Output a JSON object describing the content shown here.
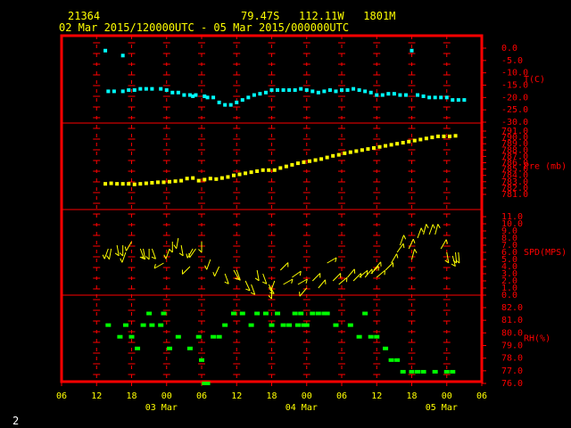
{
  "header": {
    "station": "21364",
    "location": "79.47S   112.11W   1801M",
    "period": "02 Mar 2015/120000UTC - 05 Mar 2015/000000UTC"
  },
  "footer": {
    "page": "2"
  },
  "colors": {
    "frame": "#ff0000",
    "panel_divider": "#ff0000",
    "ticks": "#ff0000",
    "axis_text": "#ff0000",
    "bottom_text": "#ffff00",
    "temperature": "#00ffff",
    "pressure": "#ffff00",
    "wind": "#ffff00",
    "rh": "#00ff00"
  },
  "chart_data": {
    "type": "scatter",
    "x_axis": {
      "unit": "hours since 02 Mar 2015 06 UTC",
      "range": [
        0,
        72
      ],
      "tick_values": [
        0,
        6,
        12,
        18,
        24,
        30,
        36,
        42,
        48,
        54,
        60,
        66,
        72
      ],
      "tick_labels": [
        "06",
        "12",
        "18",
        "00",
        "06",
        "12",
        "18",
        "00",
        "06",
        "12",
        "18",
        "00",
        "06"
      ],
      "date_labels": [
        {
          "at": 18,
          "text": "03 Mar"
        },
        {
          "at": 42,
          "text": "04 Mar"
        },
        {
          "at": 66,
          "text": "05 Mar"
        }
      ]
    },
    "panels": [
      {
        "name": "T(C)",
        "ylim": [
          -30,
          0
        ],
        "tick_labels": [
          "0.0",
          "-5.0",
          "-10.0",
          "-15.0",
          "-20.0",
          "-25.0",
          "-30.0"
        ],
        "series": [
          {
            "x": [
              7.5,
              10.5,
              8.0,
              9.0,
              10.5,
              11.5,
              12.5,
              13.5,
              14.5,
              15.5,
              17,
              18,
              19,
              20,
              21,
              22,
              22.5,
              23,
              24.5,
              25,
              26,
              27,
              28,
              29,
              30,
              31,
              32,
              33,
              34,
              35,
              36,
              37,
              38,
              39,
              40,
              41,
              42,
              43,
              44,
              45,
              46,
              47,
              48,
              49,
              50,
              51,
              52,
              53,
              54,
              55,
              56,
              57,
              58,
              59,
              60,
              61,
              62,
              63,
              64,
              65,
              66,
              67,
              68,
              69
            ],
            "y": [
              -1,
              -3,
              -17.5,
              -17.5,
              -17.5,
              -17,
              -17,
              -16.5,
              -16.5,
              -16.5,
              -16.5,
              -17,
              -18,
              -18,
              -19,
              -19,
              -19.5,
              -19,
              -19.5,
              -20,
              -20,
              -22,
              -23,
              -23,
              -22,
              -21,
              -20,
              -19,
              -18.5,
              -18,
              -17,
              -17,
              -17,
              -17,
              -17,
              -16.5,
              -17,
              -17.5,
              -18,
              -17.5,
              -17,
              -17.5,
              -17,
              -17,
              -16.5,
              -17,
              -17.5,
              -18,
              -19,
              -19,
              -18.5,
              -18.5,
              -19,
              -19,
              -1,
              -19,
              -19.5,
              -20,
              -20,
              -20,
              -20,
              -21,
              -21,
              -21,
              -21,
              -21,
              -21.5,
              -21.5,
              -21.5
            ]
          }
        ]
      },
      {
        "name": "Pre (mb)",
        "ylim": [
          780,
          792
        ],
        "tick_labels": [
          "791.0",
          "790.0",
          "789.0",
          "788.0",
          "787.0",
          "786.0",
          "785.0",
          "784.0",
          "783.0",
          "782.0",
          "781.0"
        ],
        "series": [
          {
            "x": [
              7.5,
              8.5,
              9.5,
              10.5,
              11.5,
              12.5,
              13.5,
              14.5,
              15.5,
              16.5,
              17.5,
              18.5,
              19.5,
              20.5,
              21.5,
              22.5,
              23.5,
              24.5,
              25.5,
              26.5,
              27.5,
              28.5,
              29.5,
              30.5,
              31.5,
              32.5,
              33.5,
              34.5,
              35.5,
              36.5,
              37.5,
              38.5,
              39.5,
              40.5,
              41.5,
              42.5,
              43.5,
              44.5,
              45.5,
              46.5,
              47.5,
              48.5,
              49.5,
              50.5,
              51.5,
              52.5,
              53.5,
              54.5,
              55.5,
              56.5,
              57.5,
              58.5,
              59.5,
              60.5,
              61.5,
              62.5,
              63.5,
              64.5,
              65.5,
              66.5,
              67.5
            ],
            "y": [
              782.0,
              782.1,
              782.0,
              782.0,
              782.0,
              781.9,
              782.0,
              782.1,
              782.2,
              782.3,
              782.3,
              782.4,
              782.5,
              782.6,
              783.0,
              783.1,
              782.6,
              782.8,
              783.0,
              782.9,
              783.1,
              783.3,
              783.6,
              783.8,
              784.0,
              784.2,
              784.4,
              784.6,
              784.6,
              784.6,
              785.0,
              785.3,
              785.6,
              785.9,
              786.1,
              786.3,
              786.5,
              786.7,
              787.0,
              787.3,
              787.5,
              787.8,
              788.0,
              788.2,
              788.4,
              788.6,
              788.8,
              789.0,
              789.2,
              789.4,
              789.6,
              789.8,
              790.0,
              790.2,
              790.4,
              790.6,
              790.8,
              791.0,
              791.0,
              791.0,
              791.1
            ]
          }
        ]
      },
      {
        "name": "SPD(MPS)",
        "ylim": [
          0,
          11
        ],
        "tick_labels": [
          "11.0",
          "10.0",
          "9.0",
          "8.0",
          "7.0",
          "6.0",
          "5.0",
          "4.0",
          "3.0",
          "2.0",
          "1.0",
          "0.0"
        ],
        "series": [
          {
            "x": [
              8,
              8.5,
              9.5,
              10.5,
              11,
              12,
              13.5,
              14,
              15,
              15.5,
              17.5,
              18.5,
              19,
              20,
              20.5,
              22,
              22.5,
              23,
              24,
              25.5,
              27,
              28,
              29.5,
              30,
              31.5,
              32.5,
              33.5,
              34.5,
              35.5,
              36,
              36.5,
              37.5,
              38,
              39.5,
              40.5,
              42,
              43,
              44,
              45.5,
              46.5,
              47.5,
              49,
              50,
              51,
              52,
              53,
              53.5,
              54,
              55.5,
              56.5,
              57.5,
              58,
              59.5,
              60,
              61,
              62,
              63,
              64,
              65,
              66,
              67,
              67.5,
              68
            ],
            "y": [
              6.5,
              6.5,
              7.0,
              7.0,
              6.0,
              7.5,
              6.5,
              6.5,
              6.5,
              6.5,
              4.5,
              6.5,
              7.5,
              8.0,
              7.0,
              4.0,
              6.5,
              6.5,
              7.5,
              5.0,
              4.0,
              3.0,
              3.5,
              3.5,
              2.0,
              1.5,
              3.5,
              3.0,
              1.5,
              1.0,
              2.0,
              3.5,
              1.5,
              2.5,
              1.5,
              1.0,
              2.0,
              1.0,
              4.5,
              2.0,
              1.5,
              2.5,
              2.0,
              2.5,
              2.5,
              3.0,
              3.5,
              2.5,
              3.5,
              4.5,
              6.0,
              7.0,
              6.5,
              5.0,
              8.0,
              8.5,
              8.5,
              8.5,
              6.5,
              6.0,
              5.5,
              6.0,
              6.0
            ],
            "dir": [
              200,
              190,
              170,
              180,
              200,
              210,
              160,
              170,
              180,
              160,
              240,
              200,
              180,
              190,
              170,
              225,
              210,
              215,
              180,
              200,
              205,
              160,
              150,
              160,
              155,
              160,
              170,
              160,
              150,
              180,
              200,
              45,
              60,
              55,
              60,
              220,
              45,
              40,
              60,
              45,
              50,
              40,
              45,
              50,
              40,
              45,
              40,
              50,
              45,
              30,
              35,
              20,
              25,
              15,
              20,
              15,
              20,
              15,
              30,
              170,
              165,
              175,
              175
            ]
          }
        ]
      },
      {
        "name": "RH(%)",
        "ylim": [
          76,
          82.5
        ],
        "tick_labels": [
          "82.0",
          "81.0",
          "80.0",
          "79.0",
          "78.0",
          "77.0",
          "76.0"
        ],
        "series": [
          {
            "x": [
              8,
              10,
              11,
              12,
              13,
              14,
              15,
              15.5,
              17,
              17.5,
              18.5,
              20,
              22,
              23.5,
              24,
              24.5,
              25,
              26,
              27,
              28,
              29.5,
              31,
              32.5,
              33.5,
              35,
              36,
              37,
              38,
              39,
              40,
              40.5,
              41,
              41.5,
              42,
              43,
              44,
              45,
              45.5,
              47,
              49.5,
              51,
              52,
              53,
              54,
              55.5,
              56.5,
              57.5,
              58.5,
              60,
              61,
              62,
              64,
              66,
              67
            ],
            "y": [
              81,
              80,
              81,
              80,
              79,
              81,
              82,
              81,
              81,
              82,
              79,
              80,
              79,
              80,
              78,
              76,
              76,
              80,
              80,
              81,
              82,
              82,
              81,
              82,
              82,
              81,
              82,
              81,
              81,
              82,
              81,
              82,
              81,
              81,
              82,
              82,
              82,
              82,
              81,
              81,
              80,
              82,
              80,
              80,
              79,
              78,
              78,
              77,
              77,
              77,
              77,
              77,
              77,
              77
            ]
          }
        ]
      }
    ]
  }
}
